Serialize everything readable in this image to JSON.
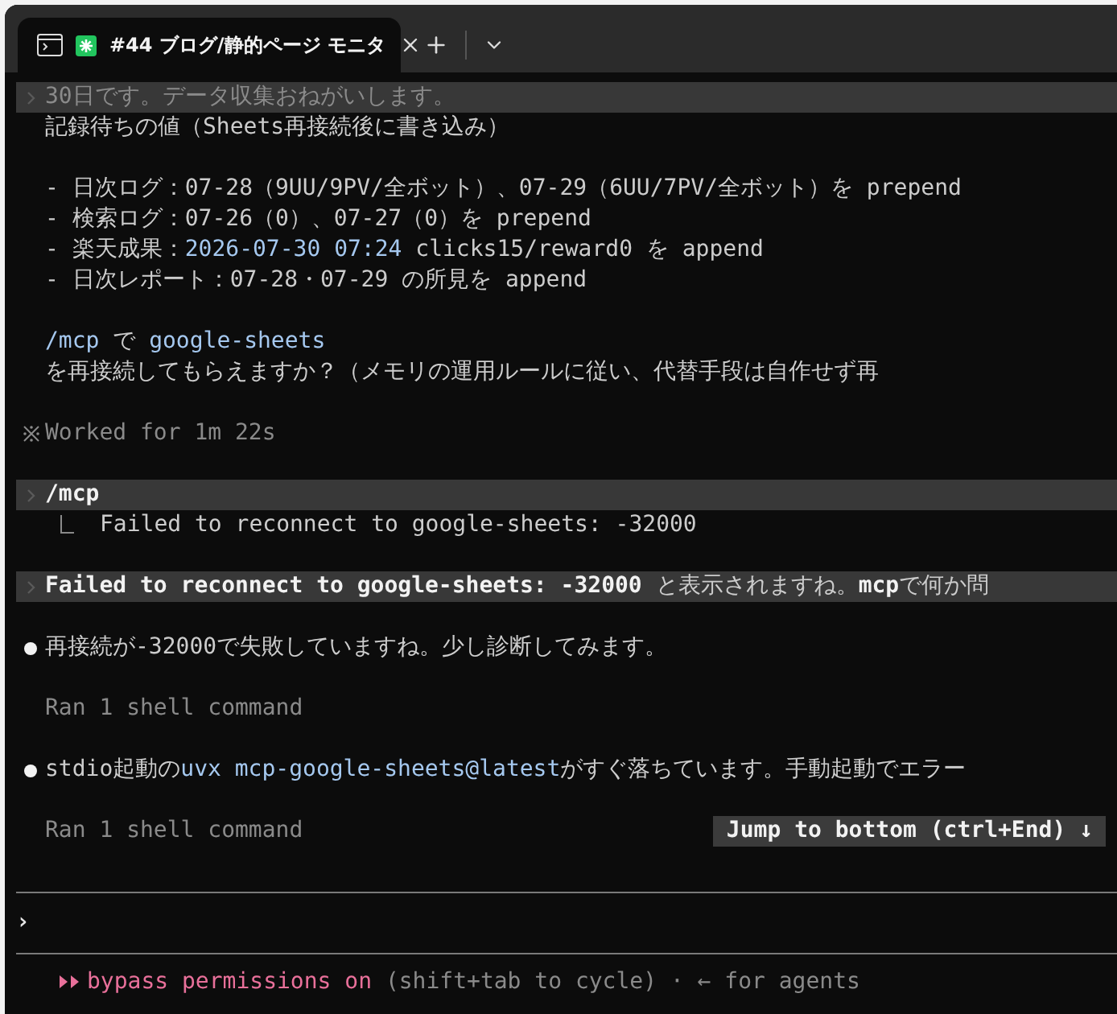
{
  "tab": {
    "title": "#44 ブログ/静的ページ モニタ"
  },
  "blocks": [
    {
      "lines": [
        {
          "kind": "prompt",
          "parts": [
            {
              "kind": "dim",
              "text": "30日です。データ収集おねがいします。"
            }
          ]
        },
        {
          "kind": "text",
          "parts": [
            {
              "kind": "plain",
              "text": "記録待ちの値（Sheets再接続後に書き込み）"
            }
          ]
        }
      ]
    },
    {
      "lines": [
        {
          "kind": "text",
          "parts": [
            {
              "kind": "plain",
              "text": "- 日次ログ：07-28（9UU/9PV/全ボット）、07-29（6UU/7PV/全ボット）を prepend"
            }
          ]
        },
        {
          "kind": "text",
          "parts": [
            {
              "kind": "plain",
              "text": "- 検索ログ：07-26（0）、07-27（0）を prepend"
            }
          ]
        },
        {
          "kind": "text",
          "parts": [
            {
              "kind": "plain",
              "text": "- 楽天成果："
            },
            {
              "kind": "accent",
              "text": "2026-07-30 07:24"
            },
            {
              "kind": "plain",
              "text": " clicks15/reward0 を append"
            }
          ]
        },
        {
          "kind": "text",
          "parts": [
            {
              "kind": "plain",
              "text": "- 日次レポート：07-28・07-29 の所見を append"
            }
          ]
        }
      ]
    },
    {
      "lines": [
        {
          "kind": "text",
          "parts": [
            {
              "kind": "accent",
              "text": "/mcp"
            },
            {
              "kind": "plain",
              "text": " で "
            },
            {
              "kind": "accent",
              "text": "google-sheets"
            }
          ]
        },
        {
          "kind": "text",
          "parts": [
            {
              "kind": "plain",
              "text": "を再接続してもらえますか？（メモリの運用ルールに従い、代替手段は自作せず再"
            }
          ]
        }
      ]
    },
    {
      "lines": [
        {
          "kind": "worked",
          "parts": [
            {
              "kind": "dim",
              "text": "Worked for 1m 22s"
            }
          ]
        }
      ]
    },
    {
      "lines": [
        {
          "kind": "prompt",
          "parts": [
            {
              "kind": "bold",
              "text": "/mcp"
            }
          ]
        },
        {
          "kind": "tree",
          "parts": [
            {
              "kind": "plain",
              "text": "Failed to reconnect to google-sheets: -32000"
            }
          ]
        }
      ]
    },
    {
      "lines": [
        {
          "kind": "prompt",
          "parts": [
            {
              "kind": "bold",
              "text": "Failed to reconnect to google-sheets: -32000"
            },
            {
              "kind": "plain",
              "text": " と表示されますね。"
            },
            {
              "kind": "bold",
              "text": "mcp"
            },
            {
              "kind": "plain",
              "text": "で何か問"
            }
          ]
        }
      ]
    },
    {
      "lines": [
        {
          "kind": "bullet",
          "parts": [
            {
              "kind": "plain",
              "text": "再接続が-32000で失敗していますね。少し診断してみます。"
            }
          ]
        }
      ]
    },
    {
      "lines": [
        {
          "kind": "text",
          "parts": [
            {
              "kind": "dim",
              "text": "Ran 1 shell command"
            }
          ]
        }
      ]
    },
    {
      "lines": [
        {
          "kind": "bullet",
          "parts": [
            {
              "kind": "plain",
              "text": "stdio起動の"
            },
            {
              "kind": "accent",
              "text": "uvx mcp-google-sheets@latest"
            },
            {
              "kind": "plain",
              "text": "がすぐ落ちています。手動起動でエラー"
            }
          ]
        }
      ]
    },
    {
      "lines": [
        {
          "kind": "text",
          "parts": [
            {
              "kind": "dim",
              "text": "Ran 1 shell command"
            }
          ]
        }
      ]
    }
  ],
  "jump_button": "Jump to bottom (ctrl+End) ↓",
  "input": {
    "prompt": "›"
  },
  "status": [
    {
      "kind": "pink",
      "text": "bypass permissions on"
    },
    {
      "kind": "dim",
      "text": " (shift+tab to cycle) · ← for agents"
    }
  ]
}
